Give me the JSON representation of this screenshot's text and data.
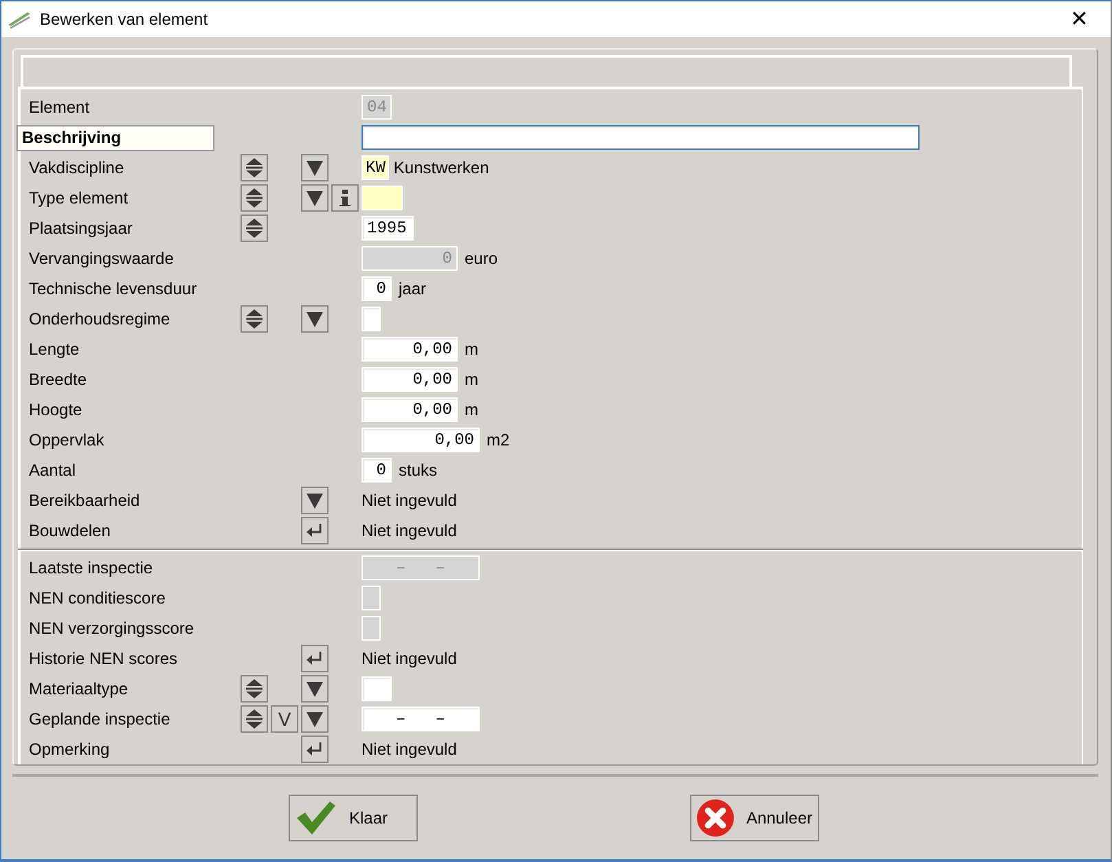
{
  "window": {
    "title": "Bewerken van element",
    "close": "✕"
  },
  "sections": [
    {
      "rows": [
        {
          "label": "Element",
          "highlighted": false,
          "controls": [],
          "value": {
            "kind": "idfield",
            "text": "04",
            "disabled": true,
            "focused": false
          }
        },
        {
          "label": "Beschrijving",
          "highlighted": true,
          "controls": [],
          "value": {
            "kind": "textfield",
            "disabled": false,
            "focused": true
          }
        },
        {
          "label": "Vakdiscipline",
          "highlighted": false,
          "controls": [
            {
              "kind": "spin"
            },
            {
              "kind": "drop"
            }
          ],
          "value": {
            "kind": "code",
            "code": "KW",
            "text": "Kunstwerken"
          }
        },
        {
          "label": "Type element",
          "highlighted": false,
          "controls": [
            {
              "kind": "spin"
            },
            {
              "kind": "drop"
            },
            {
              "kind": "info"
            }
          ],
          "value": {
            "kind": "swatch"
          }
        },
        {
          "label": "Plaatsingsjaar",
          "highlighted": false,
          "controls": [
            {
              "kind": "spin"
            }
          ],
          "value": {
            "kind": "year",
            "text": "1995",
            "disabled": false,
            "focused": false
          }
        },
        {
          "label": "Vervangingswaarde",
          "highlighted": false,
          "controls": [],
          "value": {
            "kind": "amount",
            "text": "0",
            "disabled": true,
            "focused": false,
            "unit": "euro"
          }
        },
        {
          "label": "Technische levensduur",
          "highlighted": false,
          "controls": [],
          "value": {
            "kind": "count",
            "text": "0",
            "disabled": false,
            "focused": false,
            "unit": "jaar"
          }
        },
        {
          "label": "Onderhoudsregime",
          "highlighted": false,
          "controls": [
            {
              "kind": "spin"
            },
            {
              "kind": "drop"
            }
          ],
          "value": {
            "kind": "score",
            "disabled": false,
            "focused": false
          }
        },
        {
          "label": "Lengte",
          "highlighted": false,
          "controls": [],
          "value": {
            "kind": "amount",
            "text": "0,00",
            "disabled": false,
            "focused": false,
            "unit": "m"
          }
        },
        {
          "label": "Breedte",
          "highlighted": false,
          "controls": [],
          "value": {
            "kind": "amount",
            "text": "0,00",
            "disabled": false,
            "focused": false,
            "unit": "m"
          }
        },
        {
          "label": "Hoogte",
          "highlighted": false,
          "controls": [],
          "value": {
            "kind": "amount",
            "text": "0,00",
            "disabled": false,
            "focused": false,
            "unit": "m"
          }
        },
        {
          "label": "Oppervlak",
          "highlighted": false,
          "controls": [],
          "value": {
            "kind": "area",
            "text": "0,00",
            "disabled": false,
            "focused": false,
            "unit": "m2"
          }
        },
        {
          "label": "Aantal",
          "highlighted": false,
          "controls": [],
          "value": {
            "kind": "count",
            "text": "0",
            "disabled": false,
            "focused": false,
            "unit": "stuks"
          }
        },
        {
          "label": "Bereikbaarheid",
          "highlighted": false,
          "controls": [
            {
              "kind": "drop"
            }
          ],
          "value": {
            "kind": "text",
            "text": "Niet ingevuld"
          }
        },
        {
          "label": "Bouwdelen",
          "highlighted": false,
          "controls": [
            {
              "kind": "enter"
            }
          ],
          "value": {
            "kind": "text",
            "text": "Niet ingevuld"
          }
        }
      ]
    },
    {
      "rows": [
        {
          "label": "Laatste inspectie",
          "highlighted": false,
          "controls": [],
          "value": {
            "kind": "date",
            "text": "–   –",
            "disabled": true,
            "focused": false
          }
        },
        {
          "label": "NEN conditiescore",
          "highlighted": false,
          "controls": [],
          "value": {
            "kind": "score",
            "disabled": true,
            "focused": false
          }
        },
        {
          "label": "NEN verzorgingsscore",
          "highlighted": false,
          "controls": [],
          "value": {
            "kind": "score",
            "disabled": true,
            "focused": false
          }
        },
        {
          "label": "Historie NEN scores",
          "highlighted": false,
          "controls": [
            {
              "kind": "enter"
            }
          ],
          "value": {
            "kind": "text",
            "text": "Niet ingevuld"
          }
        },
        {
          "label": "Materiaaltype",
          "highlighted": false,
          "controls": [
            {
              "kind": "spin"
            },
            {
              "kind": "drop"
            }
          ],
          "value": {
            "kind": "count",
            "disabled": false,
            "focused": false
          }
        },
        {
          "label": "Geplande inspectie",
          "highlighted": false,
          "controls": [
            {
              "kind": "spin"
            },
            {
              "kind": "letter",
              "label": "V"
            },
            {
              "kind": "drop"
            }
          ],
          "value": {
            "kind": "date",
            "text": "–   –",
            "disabled": false,
            "focused": false
          }
        },
        {
          "label": "Opmerking",
          "highlighted": false,
          "controls": [
            {
              "kind": "enter"
            }
          ],
          "value": {
            "kind": "text",
            "text": "Niet ingevuld"
          }
        }
      ]
    }
  ],
  "buttons": [
    {
      "kind": "ok",
      "label": "Klaar"
    },
    {
      "kind": "cancel",
      "label": "Annuleer"
    }
  ]
}
